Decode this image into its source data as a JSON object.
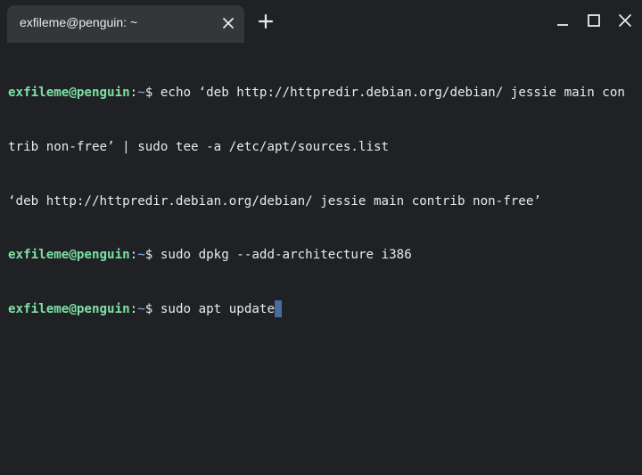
{
  "tab": {
    "title": "exfileme@penguin: ~"
  },
  "icons": {
    "tab_close": "close-icon",
    "new_tab": "plus-icon",
    "minimize": "minimize-icon",
    "maximize": "maximize-icon",
    "close": "close-icon"
  },
  "colors": {
    "background": "#202124",
    "tab_background": "#35363a",
    "prompt_user": "#7ce0a4",
    "prompt_path": "#8ab4f8",
    "text": "#e8eaed",
    "cursor": "#4a6ba0"
  },
  "terminal": {
    "prompt_user": "exfileme@penguin",
    "prompt_sep": ":",
    "prompt_path": "~",
    "prompt_symbol": "$ ",
    "line1_cmd": "echo ‘deb http://httpredir.debian.org/debian/ jessie main con",
    "line2": "trib non-free’ | sudo tee -a /etc/apt/sources.list",
    "line3": "‘deb http://httpredir.debian.org/debian/ jessie main contrib non-free’",
    "line4_cmd": "sudo dpkg --add-architecture i386",
    "line5_cmd": "sudo apt update"
  }
}
